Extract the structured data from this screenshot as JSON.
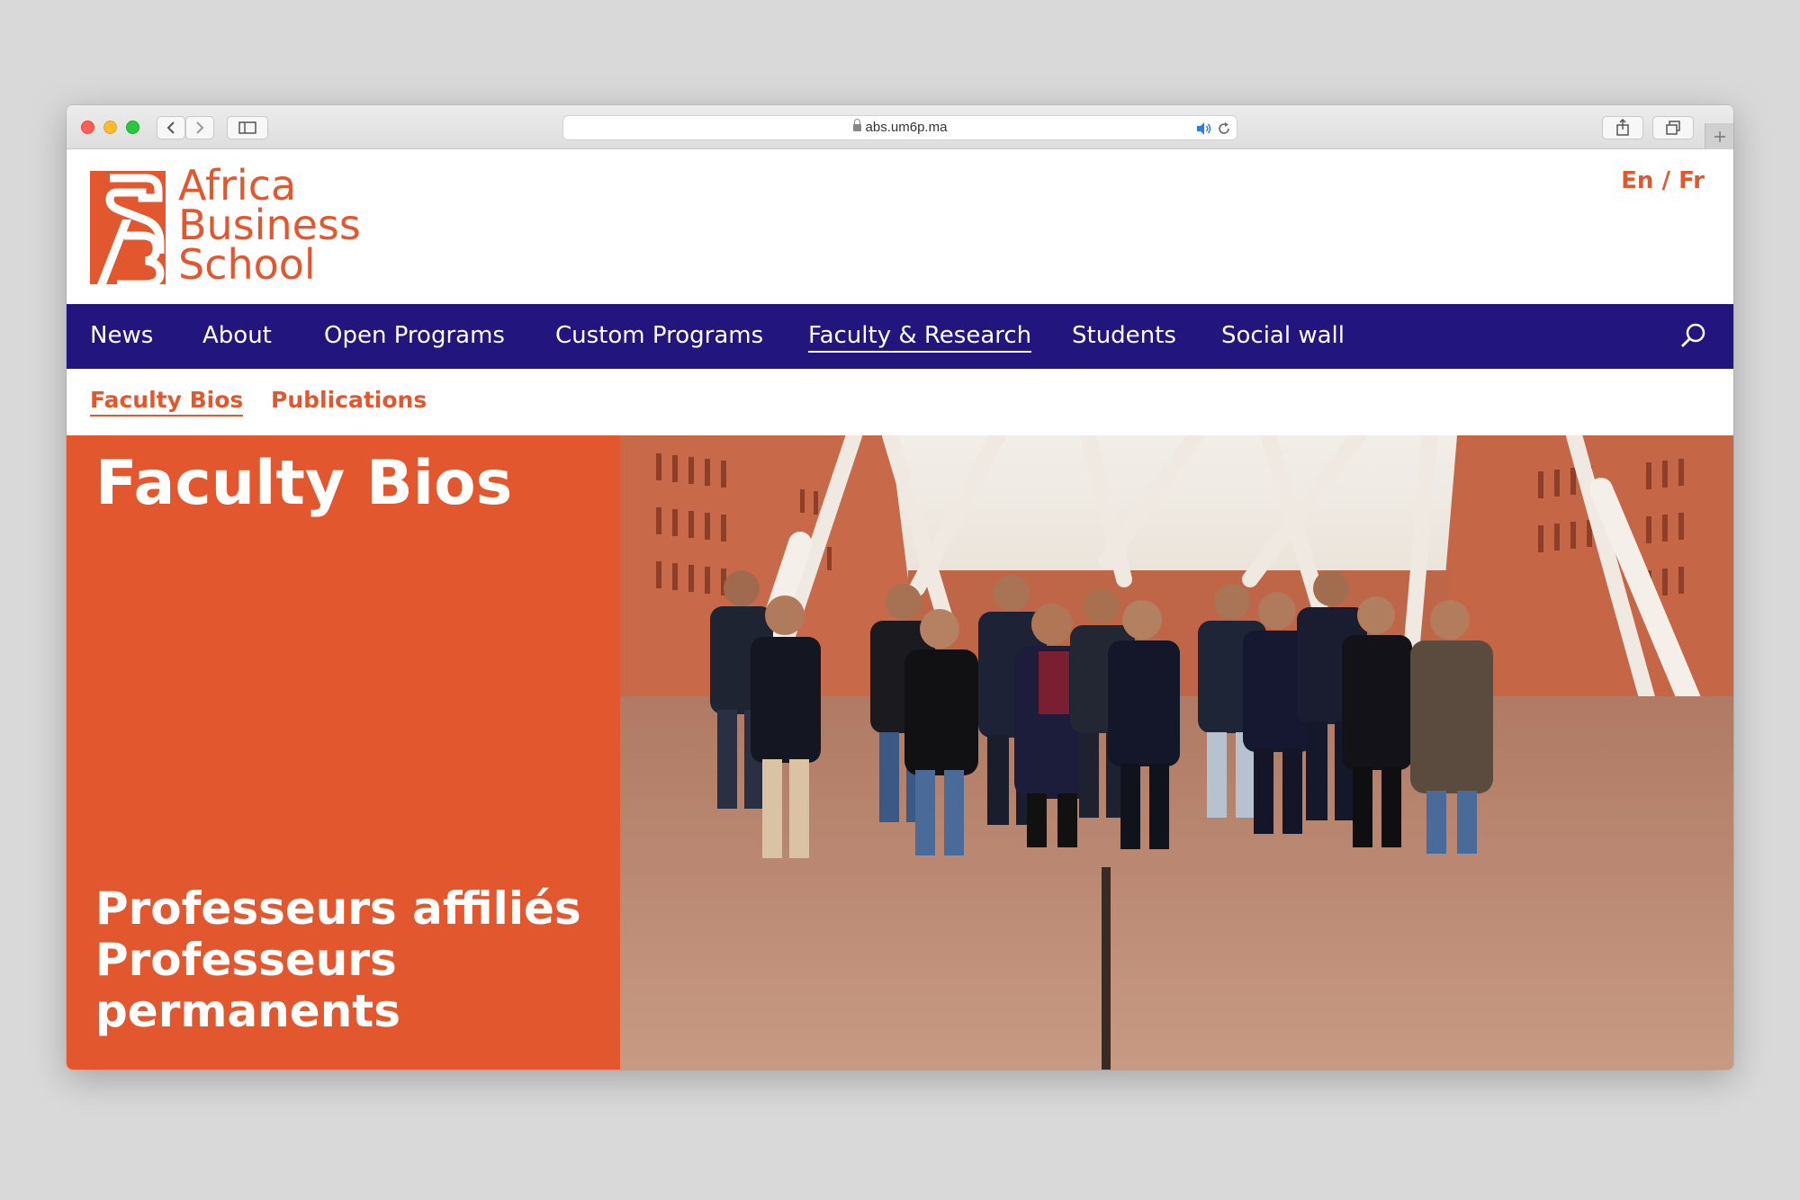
{
  "browser": {
    "url": "abs.um6p.ma"
  },
  "site": {
    "logo_lines": [
      "Africa",
      "Business",
      "School"
    ],
    "lang_en": "En",
    "lang_sep": "/",
    "lang_fr": "Fr"
  },
  "nav": {
    "items": [
      "News",
      "About",
      "Open Programs",
      "Custom Programs",
      "Faculty & Research",
      "Students",
      "Social wall"
    ],
    "active": "Faculty & Research"
  },
  "subnav": {
    "items": [
      "Faculty Bios",
      "Publications"
    ],
    "active": "Faculty Bios"
  },
  "hero": {
    "title": "Faculty Bios",
    "links": [
      "Professeurs affiliés",
      "Professeurs",
      "permanents"
    ]
  },
  "colors": {
    "brand_orange": "#e2572d",
    "nav_indigo": "#22167e"
  },
  "icons": {
    "search": "search-icon",
    "share": "share-icon",
    "tabs": "tabs-icon",
    "sidebar": "sidebar-icon",
    "back": "back-icon",
    "forward": "forward-icon",
    "audio": "speaker-icon",
    "reload": "reload-icon",
    "lock": "lock-icon"
  }
}
